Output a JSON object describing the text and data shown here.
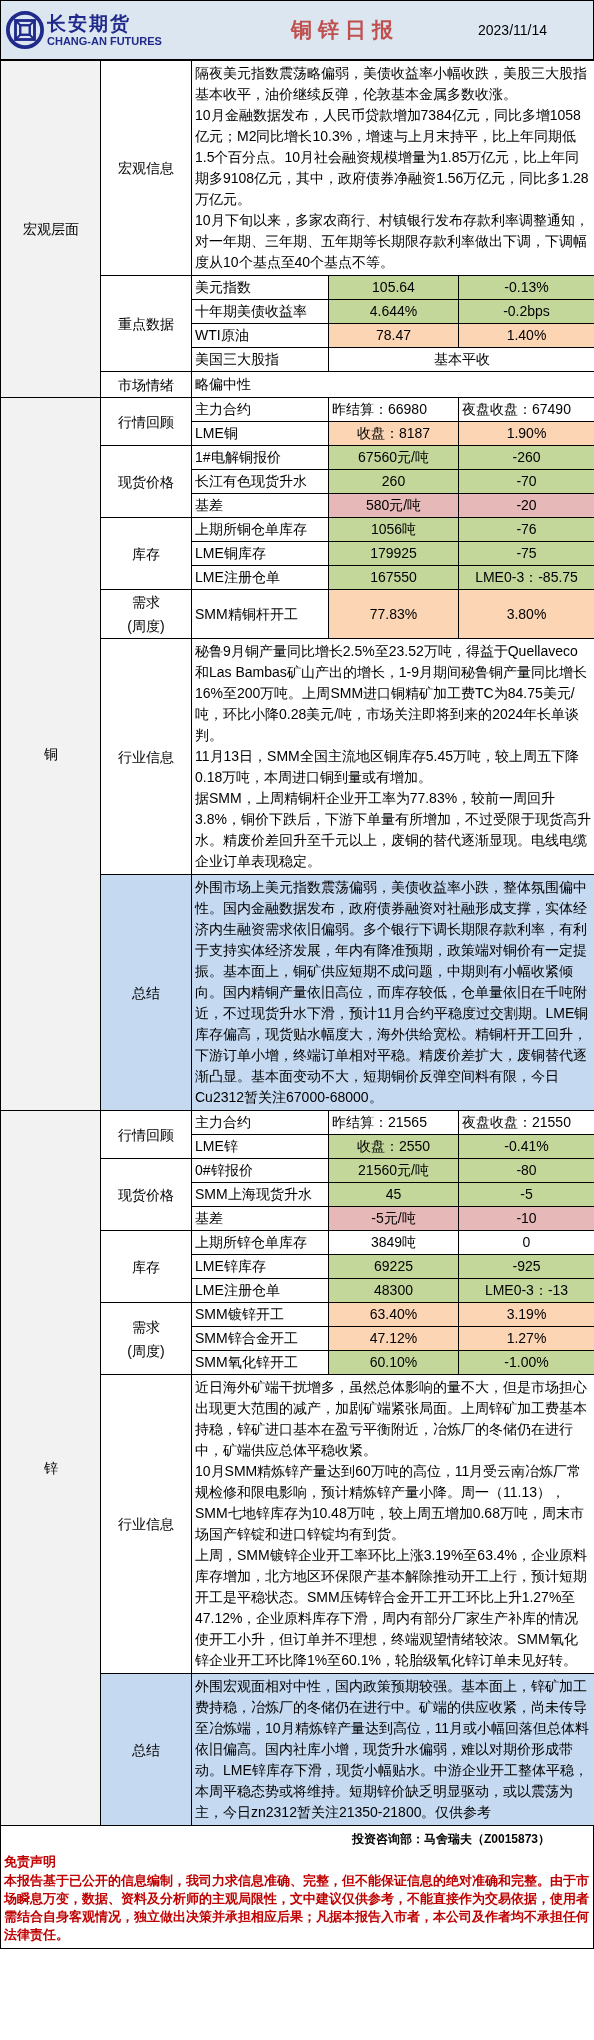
{
  "header": {
    "logo_cn": "长安期货",
    "logo_en": "CHANG-AN FUTURES",
    "title": "铜 锌 日 报",
    "date": "2023/11/14"
  },
  "sections": [
    {
      "name": "宏观层面",
      "groups": [
        {
          "label": "宏观信息",
          "kind": "text",
          "paragraphs": [
            "隔夜美元指数震荡略偏弱，美债收益率小幅收跌，美股三大股指基本收平，油价继续反弹，伦敦基本金属多数收涨。",
            "10月金融数据发布，人民币贷款增加7384亿元，同比多增1058亿元；M2同比增长10.3%，增速与上月末持平，比上年同期低1.5个百分点。10月社会融资规模增量为1.85万亿元，比上年同期多9108亿元，其中，政府债券净融资1.56万亿元，同比多1.28万亿元。",
            "10月下旬以来，多家农商行、村镇银行发布存款利率调整通知，对一年期、三年期、五年期等长期限存款利率做出下调，下调幅度从10个基点至40个基点不等。"
          ]
        },
        {
          "label": "重点数据",
          "kind": "table",
          "rows": [
            {
              "cells": [
                {
                  "text": "美元指数"
                },
                {
                  "text": "105.64",
                  "color": "#c4d79b"
                },
                {
                  "text": "-0.13%",
                  "color": "#c4d79b"
                }
              ]
            },
            {
              "cells": [
                {
                  "text": "十年期美债收益率"
                },
                {
                  "text": "4.644%",
                  "color": "#c4d79b"
                },
                {
                  "text": "-0.2bps",
                  "color": "#c4d79b"
                }
              ]
            },
            {
              "cells": [
                {
                  "text": "WTI原油"
                },
                {
                  "text": "78.47",
                  "color": "#fcd5b4"
                },
                {
                  "text": "1.40%",
                  "color": "#fcd5b4"
                }
              ]
            },
            {
              "cells": [
                {
                  "text": "美国三大股指"
                },
                {
                  "text": "基本平收",
                  "colspan": 2
                }
              ]
            }
          ]
        },
        {
          "label": "市场情绪",
          "kind": "text",
          "paragraphs": [
            "略偏中性"
          ]
        }
      ]
    },
    {
      "name": "铜",
      "groups": [
        {
          "label": "行情回顾",
          "kind": "table",
          "rows": [
            {
              "cells": [
                {
                  "text": "主力合约"
                },
                {
                  "text": "昨结算：66980"
                },
                {
                  "text": "夜盘收盘：67490"
                }
              ]
            },
            {
              "cells": [
                {
                  "text": "LME铜"
                },
                {
                  "text": "收盘：8187",
                  "color": "#fcd5b4"
                },
                {
                  "text": "1.90%",
                  "color": "#fcd5b4"
                }
              ]
            }
          ]
        },
        {
          "label": "现货价格",
          "kind": "table",
          "rows": [
            {
              "cells": [
                {
                  "text": "1#电解铜报价"
                },
                {
                  "text": "67560元/吨",
                  "color": "#c4d79b"
                },
                {
                  "text": "-260",
                  "color": "#c4d79b"
                }
              ]
            },
            {
              "cells": [
                {
                  "text": "长江有色现货升水"
                },
                {
                  "text": "260",
                  "color": "#c4d79b"
                },
                {
                  "text": "-70",
                  "color": "#c4d79b"
                }
              ]
            },
            {
              "cells": [
                {
                  "text": "基差"
                },
                {
                  "text": "580元/吨",
                  "color": "#e6b8b7"
                },
                {
                  "text": "-20",
                  "color": "#e6b8b7"
                }
              ]
            }
          ]
        },
        {
          "label": "库存",
          "kind": "table",
          "rows": [
            {
              "cells": [
                {
                  "text": "上期所铜仓单库存"
                },
                {
                  "text": "1056吨",
                  "color": "#c4d79b"
                },
                {
                  "text": "-76",
                  "color": "#c4d79b"
                }
              ]
            },
            {
              "cells": [
                {
                  "text": "LME铜库存"
                },
                {
                  "text": "179925",
                  "color": "#c4d79b"
                },
                {
                  "text": "-75",
                  "color": "#c4d79b"
                }
              ]
            },
            {
              "cells": [
                {
                  "text": "LME注册仓单"
                },
                {
                  "text": "167550",
                  "color": "#c4d79b"
                },
                {
                  "text": "LME0-3：-85.75",
                  "color": "#c4d79b"
                }
              ]
            }
          ]
        },
        {
          "label": "需求",
          "sublabel": "(周度)",
          "kind": "table",
          "rows": [
            {
              "cells": [
                {
                  "text": "SMM精铜杆开工"
                },
                {
                  "text": "77.83%",
                  "color": "#fcd5b4"
                },
                {
                  "text": "3.80%",
                  "color": "#fcd5b4"
                }
              ]
            }
          ]
        },
        {
          "label": "行业信息",
          "kind": "text",
          "paragraphs": [
            "秘鲁9月铜产量同比增长2.5%至23.52万吨，得益于Quellaveco和Las Bambas矿山产出的增长，1-9月期间秘鲁铜产量同比增长16%至200万吨。上周SMM进口铜精矿加工费TC为84.75美元/吨，环比小降0.28美元/吨，市场关注即将到来的2024年长单谈判。",
            "11月13日，SMM全国主流地区铜库存5.45万吨，较上周五下降0.18万吨，本周进口铜到量或有增加。",
            "据SMM，上周精铜杆企业开工率为77.83%，较前一周回升3.8%，铜价下跌后，下游下单量有所增加，不过受限于现货高升水。精废价差回升至千元以上，废铜的替代逐渐显现。电线电缆企业订单表现稳定。"
          ]
        },
        {
          "label": "总结",
          "kind": "summary",
          "paragraphs": [
            "外围市场上美元指数震荡偏弱，美债收益率小跌，整体氛围偏中性。国内金融数据发布，政府债券融资对社融形成支撑，实体经济内生融资需求依旧偏弱。多个银行下调长期限存款利率，有利于支持实体经济发展，年内有降准预期，政策端对铜价有一定提振。基本面上，铜矿供应短期不成问题，中期则有小幅收紧倾向。国内精铜产量依旧高位，而库存较低，仓单量依旧在千吨附近，不过现货升水下滑，预计11月合约平稳度过交割期。LME铜库存偏高，现货贴水幅度大，海外供给宽松。精铜杆开工回升，下游订单小增，终端订单相对平稳。精废价差扩大，废铜替代逐渐凸显。基本面变动不大，短期铜价反弹空间料有限，今日Cu2312暂关注67000-68000。"
          ]
        }
      ]
    },
    {
      "name": "锌",
      "groups": [
        {
          "label": "行情回顾",
          "kind": "table",
          "rows": [
            {
              "cells": [
                {
                  "text": "主力合约"
                },
                {
                  "text": "昨结算：21565"
                },
                {
                  "text": "夜盘收盘：21550"
                }
              ]
            },
            {
              "cells": [
                {
                  "text": "LME锌"
                },
                {
                  "text": "收盘：2550",
                  "color": "#c4d79b"
                },
                {
                  "text": "-0.41%",
                  "color": "#c4d79b"
                }
              ]
            }
          ]
        },
        {
          "label": "现货价格",
          "kind": "table",
          "rows": [
            {
              "cells": [
                {
                  "text": "0#锌报价"
                },
                {
                  "text": "21560元/吨",
                  "color": "#c4d79b"
                },
                {
                  "text": "-80",
                  "color": "#c4d79b"
                }
              ]
            },
            {
              "cells": [
                {
                  "text": "SMM上海现货升水"
                },
                {
                  "text": "45",
                  "color": "#c4d79b"
                },
                {
                  "text": "-5",
                  "color": "#c4d79b"
                }
              ]
            },
            {
              "cells": [
                {
                  "text": "基差"
                },
                {
                  "text": "-5元/吨",
                  "color": "#e6b8b7"
                },
                {
                  "text": "-10",
                  "color": "#e6b8b7"
                }
              ]
            }
          ]
        },
        {
          "label": "库存",
          "kind": "table",
          "rows": [
            {
              "cells": [
                {
                  "text": "上期所锌仓单库存"
                },
                {
                  "text": "3849吨"
                },
                {
                  "text": "0"
                }
              ]
            },
            {
              "cells": [
                {
                  "text": "LME锌库存"
                },
                {
                  "text": "69225",
                  "color": "#c4d79b"
                },
                {
                  "text": "-925",
                  "color": "#c4d79b"
                }
              ]
            },
            {
              "cells": [
                {
                  "text": "LME注册仓单"
                },
                {
                  "text": "48300",
                  "color": "#c4d79b"
                },
                {
                  "text": "LME0-3：-13",
                  "color": "#c4d79b"
                }
              ]
            }
          ]
        },
        {
          "label": "需求",
          "sublabel": "(周度)",
          "kind": "table",
          "rows": [
            {
              "cells": [
                {
                  "text": "SMM镀锌开工"
                },
                {
                  "text": "63.40%",
                  "color": "#fcd5b4"
                },
                {
                  "text": "3.19%",
                  "color": "#fcd5b4"
                }
              ]
            },
            {
              "cells": [
                {
                  "text": "SMM锌合金开工"
                },
                {
                  "text": "47.12%",
                  "color": "#fcd5b4"
                },
                {
                  "text": "1.27%",
                  "color": "#fcd5b4"
                }
              ]
            },
            {
              "cells": [
                {
                  "text": "SMM氧化锌开工"
                },
                {
                  "text": "60.10%",
                  "color": "#c4d79b"
                },
                {
                  "text": "-1.00%",
                  "color": "#c4d79b"
                }
              ]
            }
          ]
        },
        {
          "label": "行业信息",
          "kind": "text",
          "paragraphs": [
            "近日海外矿端干扰增多，虽然总体影响的量不大，但是市场担心出现更大范围的减产，加剧矿端紧张局面。上周锌矿加工费基本持稳，锌矿进口基本在盈亏平衡附近，冶炼厂的冬储仍在进行中，矿端供应总体平稳收紧。",
            "10月SMM精炼锌产量达到60万吨的高位，11月受云南冶炼厂常规检修和限电影响，预计精炼锌产量小降。周一（11.13），SMM七地锌库存为10.48万吨，较上周五增加0.68万吨，周末市场国产锌锭和进口锌锭均有到货。",
            "上周，SMM镀锌企业开工率环比上涨3.19%至63.4%，企业原料库存增加，北方地区环保限产基本解除推动开工上行，预计短期开工是平稳状态。SMM压铸锌合金开工开工环比上升1.27%至47.12%，企业原料库存下滑，周内有部分厂家生产补库的情况使开工小升，但订单并不理想，终端观望情绪较浓。SMM氧化锌企业开工环比降1%至60.1%，轮胎级氧化锌订单未见好转。"
          ]
        },
        {
          "label": "总结",
          "kind": "summary",
          "paragraphs": [
            "外围宏观面相对中性，国内政策预期较强。基本面上，锌矿加工费持稳，冶炼厂的冬储仍在进行中。矿端的供应收紧，尚未传导至冶炼端，10月精炼锌产量达到高位，11月或小幅回落但总体料依旧偏高。国内社库小增，现货升水偏弱，难以对期价形成带动。LME锌库存下滑，现货小幅贴水。中游企业开工整体平稳，本周平稳态势或将维持。短期锌价缺乏明显驱动，或以震荡为主，今日zn2312暂关注21350-21800。仅供参考"
          ]
        }
      ]
    }
  ],
  "footer": {
    "analyst": "投资咨询部：马舍瑞夫（Z0015873）",
    "disclaimer_title": "免责声明",
    "disclaimer": "本报告基于已公开的信息编制，我司力求信息准确、完整，但不能保证信息的绝对准确和完整。由于市场瞬息万变，数据、资料及分析师的主观局限性，文中建议仅供参考，不能直接作为交易依据，使用者需结合自身客观情况，独立做出决策并承担相应后果；凡据本报告入市者，本公司及作者均不承担任何法律责任。"
  }
}
